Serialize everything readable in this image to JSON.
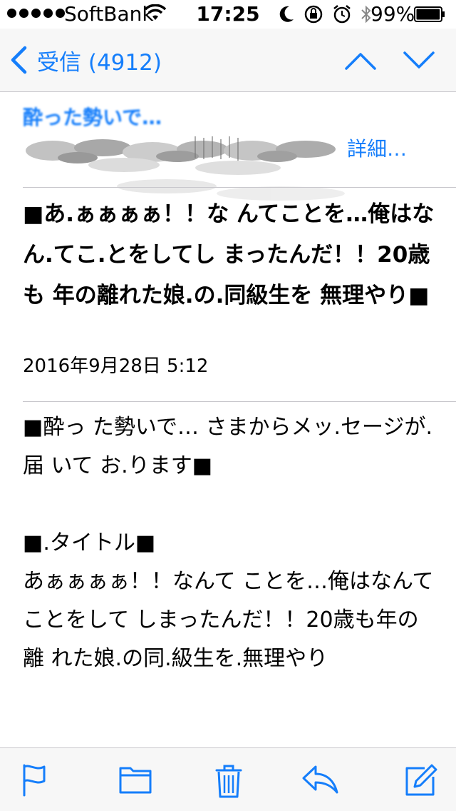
{
  "status_bar": {
    "carrier": "SoftBank",
    "time": "17:25",
    "battery_percent": "99%",
    "battery_level": 0.99,
    "signal_bars": 5
  },
  "nav": {
    "back_label": "受信 (4912)",
    "up_icon": "chevron-up-icon",
    "down_icon": "chevron-down-icon"
  },
  "header": {
    "sender": "酔った勢いで…",
    "details_label": "詳細…"
  },
  "message": {
    "subject": "■あ.ぁぁぁぁ！！な んてことを…俺はなん.てこ.とをしてし まったんだ！！20歳も 年の離れた娘.の.同級生を 無理やり■",
    "date": "2016年9月28日 5:12",
    "body_1": "■酔っ た勢いで… さまからメッ.セージが.届 いて お.ります■",
    "body_2": "■.タイトル■",
    "body_3": "あぁぁぁぁ！！なんて ことを…俺はなんてことをして しまったんだ！！20歳も年の離 れた娘.の同.級生を.無理やり"
  },
  "toolbar": {
    "icons": [
      "flag-icon",
      "folder-icon",
      "trash-icon",
      "reply-icon",
      "compose-icon"
    ]
  },
  "colors": {
    "accent": "#157efb",
    "separator": "#c8c7cc",
    "bar_background": "#f7f7f7"
  }
}
